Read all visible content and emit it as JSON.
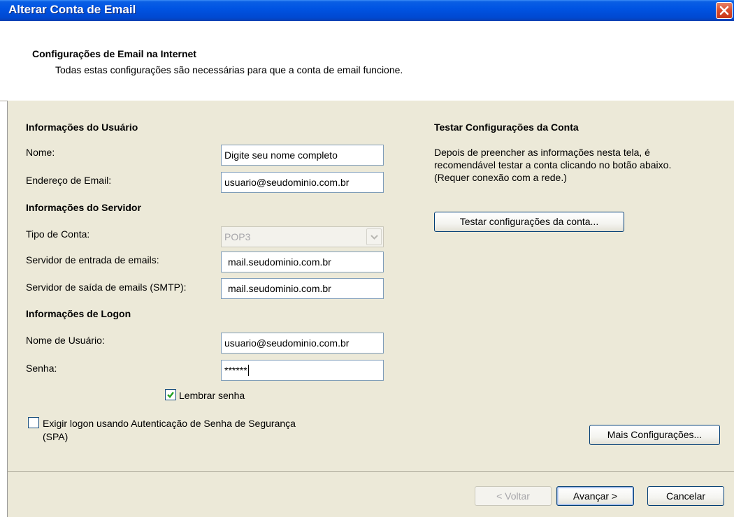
{
  "window": {
    "title": "Alterar Conta de Email"
  },
  "header": {
    "title": "Configurações de Email na Internet",
    "subtitle": "Todas estas configurações são necessárias para que a conta de email funcione."
  },
  "user_info": {
    "heading": "Informações do Usuário",
    "name_label": "Nome:",
    "name_value": "Digite seu nome completo",
    "email_label": "Endereço de Email:",
    "email_value": "usuario@seudominio.com.br"
  },
  "server_info": {
    "heading": "Informações do Servidor",
    "account_type_label": "Tipo de Conta:",
    "account_type_value": "POP3",
    "incoming_label": "Servidor de entrada de emails:",
    "incoming_value": "mail.seudominio.com.br",
    "outgoing_label": "Servidor de saída de emails (SMTP):",
    "outgoing_value": "mail.seudominio.com.br"
  },
  "logon_info": {
    "heading": "Informações de Logon",
    "username_label": "Nome de Usuário:",
    "username_value": "usuario@seudominio.com.br",
    "password_label": "Senha:",
    "password_value": "******",
    "remember_label": "Lembrar senha",
    "remember_checked": true,
    "spa_label_line1": "Exigir logon usando Autenticação de Senha de Segurança",
    "spa_label_line2": "(SPA)",
    "spa_checked": false
  },
  "test_settings": {
    "heading": "Testar Configurações da Conta",
    "description_line1": "Depois de preencher as informações nesta tela, é",
    "description_line2": "recomendável testar a conta clicando no botão abaixo.",
    "description_line3": "(Requer conexão com a rede.)",
    "test_button": "Testar configurações da conta..."
  },
  "more_settings_button": "Mais Configurações...",
  "footer": {
    "back_button": "< Voltar",
    "next_button": "Avançar >",
    "cancel_button": "Cancelar"
  },
  "colors": {
    "titlebar": "#0054e3",
    "dialog_bg": "#ece9d8",
    "check_green": "#21a121"
  }
}
